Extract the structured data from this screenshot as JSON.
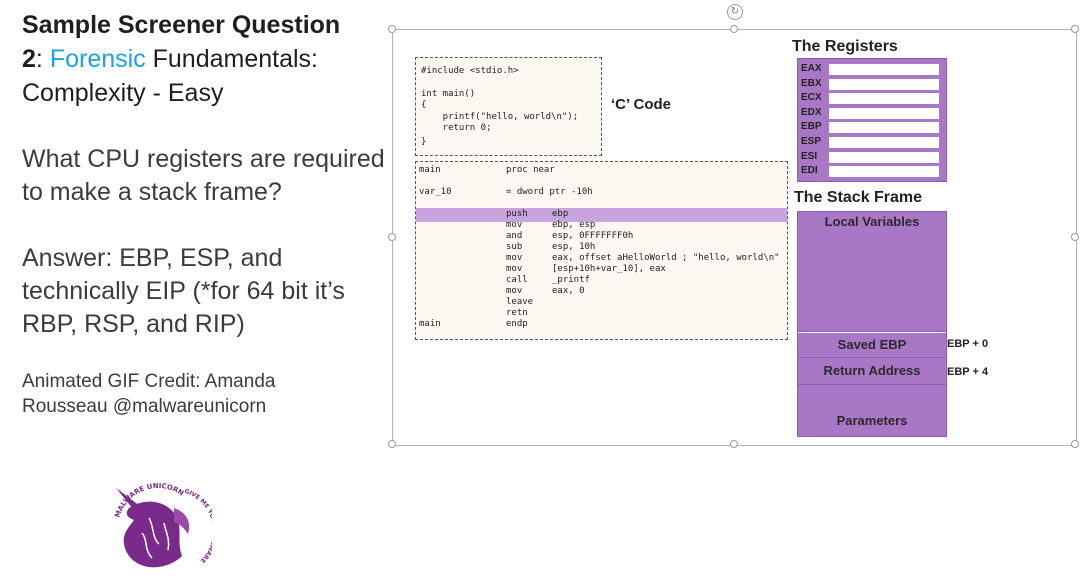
{
  "slide": {
    "title_bold": "Sample Screener Question",
    "title_num": "2",
    "title_colon": ": ",
    "title_accent": "Forensic",
    "title_rest": " Fundamentals:",
    "title_line3": "Complexity - Easy",
    "question": "What CPU registers are required to make a stack frame?",
    "answer": "Answer: EBP, ESP, and technically EIP (*for 64 bit it’s RBP, RSP, and RIP)",
    "credit": "Animated GIF Credit: Amanda Rousseau @malwareunicorn",
    "accent_color": "#1aa3e0"
  },
  "figure": {
    "c_code_label": "‘C’ Code",
    "c_code": [
      "#include <stdio.h>",
      "",
      "int main()",
      "{",
      "    printf(\"hello, world\\n\");",
      "    return 0;",
      "}"
    ],
    "asm_rows": [
      [
        "main",
        "proc near",
        ""
      ],
      [
        "",
        "",
        ""
      ],
      [
        "var_10",
        "= dword ptr -10h",
        ""
      ],
      [
        "",
        "",
        ""
      ],
      [
        "",
        "push",
        "ebp"
      ],
      [
        "",
        "mov",
        "ebp, esp"
      ],
      [
        "",
        "and",
        "esp, 0FFFFFFF0h"
      ],
      [
        "",
        "sub",
        "esp, 10h"
      ],
      [
        "",
        "mov",
        "eax, offset aHelloWorld ; \"hello, world\\n\""
      ],
      [
        "",
        "mov",
        "[esp+10h+var_10], eax"
      ],
      [
        "",
        "call",
        "_printf"
      ],
      [
        "",
        "mov",
        "eax, 0"
      ],
      [
        "",
        "leave",
        ""
      ],
      [
        "",
        "retn",
        ""
      ],
      [
        "main",
        "endp",
        ""
      ]
    ],
    "registers_title": "The Registers",
    "registers": [
      "EAX",
      "EBX",
      "ECX",
      "EDX",
      "EBP",
      "ESP",
      "ESI",
      "EDI"
    ],
    "stack_title": "The Stack Frame",
    "stack_segments": [
      "Local Variables",
      "Saved EBP",
      "Return Address",
      "Parameters"
    ],
    "offsets": [
      "EBP + 0",
      "EBP + 4"
    ],
    "purple": "#a878c7",
    "highlight": "#c9a3dc"
  },
  "logo": {
    "text_top": "MALWARE UNICORN",
    "text_right": "GIVE ME YOUR MALWARE",
    "icon": "unicorn-logo-icon"
  }
}
